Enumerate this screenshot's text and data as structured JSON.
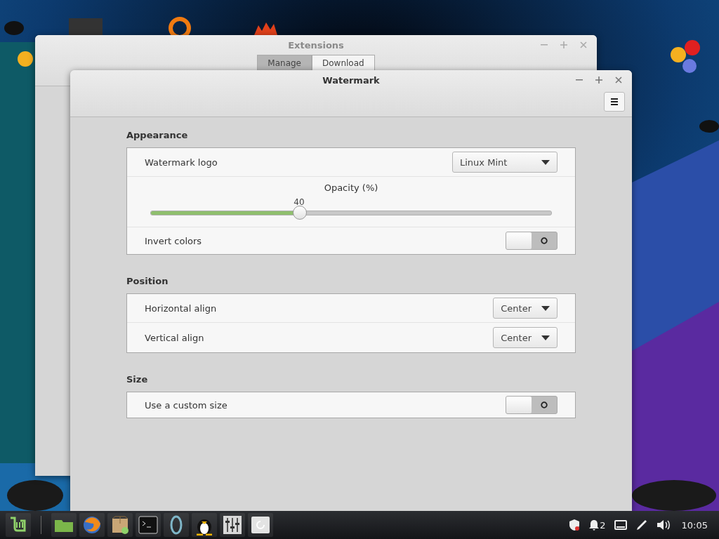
{
  "background_window": {
    "title": "Extensions",
    "tabs": [
      {
        "label": "Manage",
        "selected": true
      },
      {
        "label": "Download",
        "selected": false
      }
    ]
  },
  "window": {
    "title": "Watermark"
  },
  "sections": [
    {
      "title": "Appearance",
      "rows": [
        {
          "kind": "dropdown",
          "label": "Watermark logo",
          "value": "Linux Mint"
        },
        {
          "kind": "slider",
          "label": "Opacity (%)",
          "reading": "40",
          "level": 0.37
        },
        {
          "kind": "switch",
          "label": "Invert colors",
          "on": false
        }
      ]
    },
    {
      "title": "Position",
      "rows": [
        {
          "kind": "dropdown",
          "label": "Horizontal align",
          "value": "Center"
        },
        {
          "kind": "dropdown",
          "label": "Vertical align",
          "value": "Center"
        }
      ]
    },
    {
      "title": "Size",
      "rows": [
        {
          "kind": "switch",
          "label": "Use a custom size",
          "on": false
        }
      ]
    }
  ],
  "taskbar": {
    "notifications": "2",
    "clock": "10:05"
  }
}
